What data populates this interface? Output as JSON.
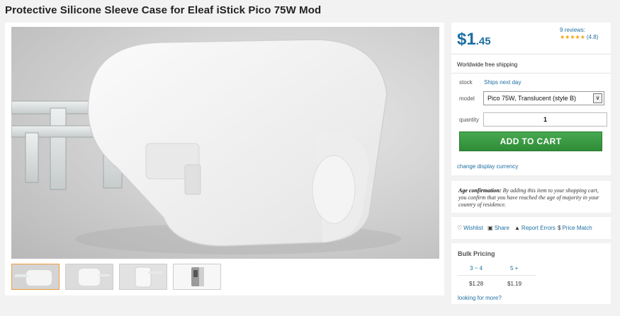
{
  "product": {
    "title": "Protective Silicone Sleeve Case for Eleaf iStick Pico 75W Mod"
  },
  "gallery": {
    "thumbnails": [
      {
        "name": "thumb-1",
        "active": true
      },
      {
        "name": "thumb-2",
        "active": false
      },
      {
        "name": "thumb-3",
        "active": false
      },
      {
        "name": "thumb-4",
        "active": false
      }
    ]
  },
  "pricing": {
    "dollars": "$1",
    "cents": ".45",
    "reviews_label": "9 reviews:",
    "stars": "★★★★★",
    "rating": "(4.8)",
    "shipping": "Worldwide free shipping"
  },
  "options": {
    "stock_label": "stock",
    "stock_value": "Ships next day",
    "model_label": "model",
    "model_value": "Pico 75W, Translucent (style B)",
    "quantity_label": "quantity",
    "quantity_value": "1",
    "add_to_cart": "ADD TO CART",
    "change_currency": "change display currency"
  },
  "age": {
    "heading": "Age confirmation:",
    "text": "By adding this item to your shopping cart, you confirm that you have reached the age of majority in your country of residence."
  },
  "actions": {
    "wishlist": "Wishlist",
    "share": "Share",
    "report": "Report Errors",
    "price_match": "Price Match"
  },
  "bulk": {
    "title": "Bulk Pricing",
    "tiers": [
      {
        "qty": "3 ~ 4",
        "price": "$1.28"
      },
      {
        "qty": "5 +",
        "price": "$1.19"
      }
    ],
    "more": "looking for more?"
  },
  "colors": {
    "accent": "#1d6fa3",
    "cart_green": "#3a9a43",
    "star": "#f2a20f",
    "thumb_active": "#f29c3a"
  }
}
